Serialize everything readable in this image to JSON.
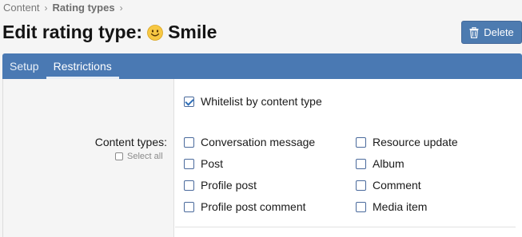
{
  "breadcrumb": {
    "items": [
      {
        "label": "Content"
      },
      {
        "label": "Rating types"
      }
    ],
    "separator": "›"
  },
  "header": {
    "title_prefix": "Edit rating type:",
    "title_name": "Smile",
    "icon": "smile-emoji-icon",
    "delete_label": "Delete"
  },
  "tabs": [
    {
      "label": "Setup",
      "active": false
    },
    {
      "label": "Restrictions",
      "active": true
    }
  ],
  "restrictions": {
    "whitelist_label": "Whitelist by content type",
    "whitelist_checked": true,
    "content_types_label": "Content types:",
    "select_all_label": "Select all",
    "options": [
      {
        "label": "Conversation message",
        "checked": false
      },
      {
        "label": "Post",
        "checked": false
      },
      {
        "label": "Profile post",
        "checked": false
      },
      {
        "label": "Profile post comment",
        "checked": false
      },
      {
        "label": "Resource update",
        "checked": false
      },
      {
        "label": "Album",
        "checked": false
      },
      {
        "label": "Comment",
        "checked": false
      },
      {
        "label": "Media item",
        "checked": false
      }
    ]
  },
  "colors": {
    "accent": "#4a79b3",
    "button": "#4d7bb0"
  }
}
